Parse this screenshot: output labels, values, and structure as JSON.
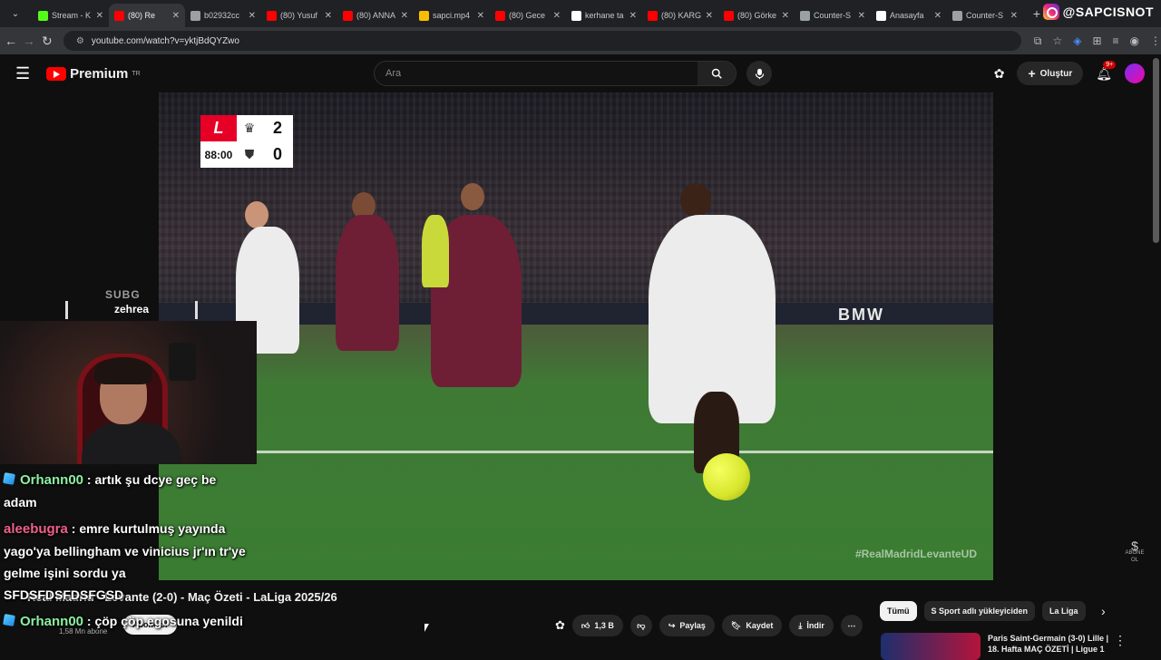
{
  "browser": {
    "tabs": [
      {
        "label": "Stream - K",
        "color": "#53fc18",
        "active": false
      },
      {
        "label": "(80) Re",
        "color": "#ff0000",
        "active": true
      },
      {
        "label": "b02932cc",
        "color": "#9aa0a6",
        "active": false
      },
      {
        "label": "(80) Yusuf",
        "color": "#ff0000",
        "active": false
      },
      {
        "label": "(80) ANNA",
        "color": "#ff0000",
        "active": false
      },
      {
        "label": "sapci.mp4",
        "color": "#fbbc04",
        "active": false
      },
      {
        "label": "(80) Gece",
        "color": "#ff0000",
        "active": false
      },
      {
        "label": "kerhane ta",
        "color": "#ffffff",
        "active": false
      },
      {
        "label": "(80) KARG",
        "color": "#ff0000",
        "active": false
      },
      {
        "label": "(80) Görke",
        "color": "#ff0000",
        "active": false
      },
      {
        "label": "Counter-S",
        "color": "#9aa0a6",
        "active": false
      },
      {
        "label": "Anasayfa",
        "color": "#ffffff",
        "active": false
      },
      {
        "label": "Counter-S",
        "color": "#9aa0a6",
        "active": false
      }
    ],
    "url": "youtube.com/watch?v=yktjBdQYZwo"
  },
  "instagram_handle": "@SAPCISNOT",
  "youtube": {
    "logo_text": "Premium",
    "logo_sup": "TR",
    "search_placeholder": "Ara",
    "create_label": "Oluştur",
    "notif_count": "9+"
  },
  "video": {
    "score_time": "88:00",
    "home_score": "2",
    "away_score": "0",
    "hashtag": "#RealMadridLevanteUD",
    "adboard": "BMW",
    "watermark": "ABONE OL"
  },
  "stream_overlay": {
    "sub_label": "SUBG",
    "sub_user": "zehrea",
    "chat": [
      {
        "user": "Orhann00",
        "text": ": artık şu dcye geç be adam",
        "user_color": "#8bf0a1",
        "badge": true
      },
      {
        "user": "aleebugra",
        "text": ": emre kurtulmuş yayında yago'ya bellingham ve vinicius jr'ın tr'ye gelme işini sordu ya SFDSFDSFDSFGSD",
        "user_color": "#f0608a",
        "badge": false
      },
      {
        "user": "Orhann00",
        "text": ": çöp çöp egosuna yenildi",
        "user_color": "#8bf0a1",
        "badge": true
      }
    ]
  },
  "video_info": {
    "title": "Real Madrid - Levante (2-0) - Maç Özeti - LaLiga 2025/26",
    "subscribers": "1,58 Mn abone",
    "subscribe_label": "Abone ol"
  },
  "actions": {
    "like_count": "1,3 B",
    "share": "Paylaş",
    "save": "Kaydet",
    "download": "İndir"
  },
  "chips": [
    "Tümü",
    "S Sport adlı yükleyiciden",
    "La Liga"
  ],
  "recommendation": {
    "title": "Paris Saint-Germain (3-0) Lille | 18. Hafta MAÇ ÖZETİ | Ligue 1"
  }
}
